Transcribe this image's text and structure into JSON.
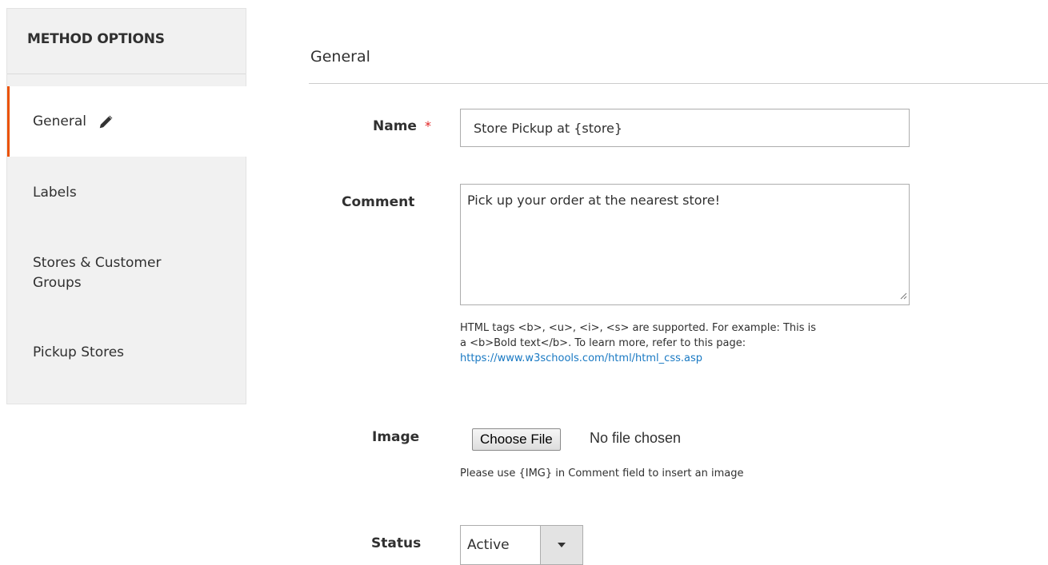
{
  "sidebar": {
    "title": "METHOD OPTIONS",
    "items": [
      {
        "label": "General"
      },
      {
        "label": "Labels"
      },
      {
        "label": "Stores & Customer Groups"
      },
      {
        "label": "Pickup Stores"
      }
    ]
  },
  "section": {
    "title": "General"
  },
  "form": {
    "name": {
      "label": "Name",
      "required_mark": "*",
      "value": "Store Pickup at {store}"
    },
    "comment": {
      "label": "Comment",
      "value": "Pick up your order at the nearest store!",
      "note_line1": "HTML tags <b>, <u>, <i>, <s> are supported. For example: This is",
      "note_line2": "a <b>Bold text</b>. To learn more, refer to this page:",
      "note_link": "https://www.w3schools.com/html/html_css.asp"
    },
    "image": {
      "label": "Image",
      "button_label": "Choose File",
      "file_status": "No file chosen",
      "note": "Please use {IMG} in Comment field to insert an image"
    },
    "status": {
      "label": "Status",
      "value": "Active"
    }
  },
  "colors": {
    "accent": "#eb5202",
    "link": "#1979c3",
    "required": "#e22626"
  }
}
